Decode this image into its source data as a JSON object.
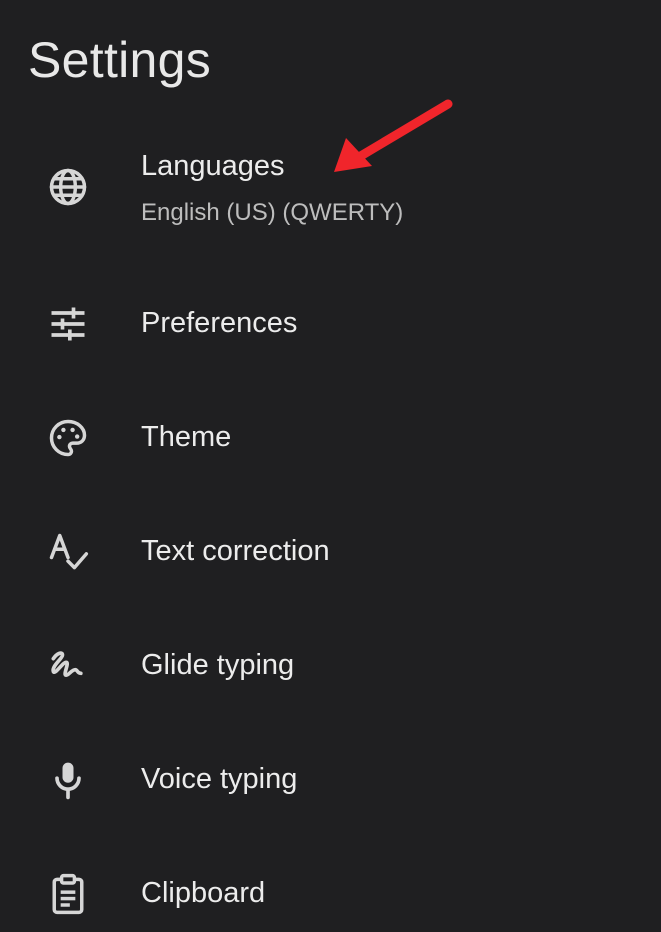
{
  "header": {
    "title": "Settings"
  },
  "items": [
    {
      "id": "languages",
      "label": "Languages",
      "sublabel": "English (US) (QWERTY)",
      "icon": "globe-icon"
    },
    {
      "id": "preferences",
      "label": "Preferences",
      "icon": "sliders-icon"
    },
    {
      "id": "theme",
      "label": "Theme",
      "icon": "palette-icon"
    },
    {
      "id": "text-correction",
      "label": "Text correction",
      "icon": "spellcheck-icon"
    },
    {
      "id": "glide-typing",
      "label": "Glide typing",
      "icon": "gesture-icon"
    },
    {
      "id": "voice-typing",
      "label": "Voice typing",
      "icon": "microphone-icon"
    },
    {
      "id": "clipboard",
      "label": "Clipboard",
      "icon": "clipboard-icon"
    }
  ],
  "annotation": {
    "color": "#f0252b",
    "icon": "red-arrow-icon"
  },
  "colors": {
    "background": "#1f1f21",
    "text_primary": "#ececec",
    "text_secondary": "#bdbdbd",
    "icon": "#d6d6d6"
  }
}
